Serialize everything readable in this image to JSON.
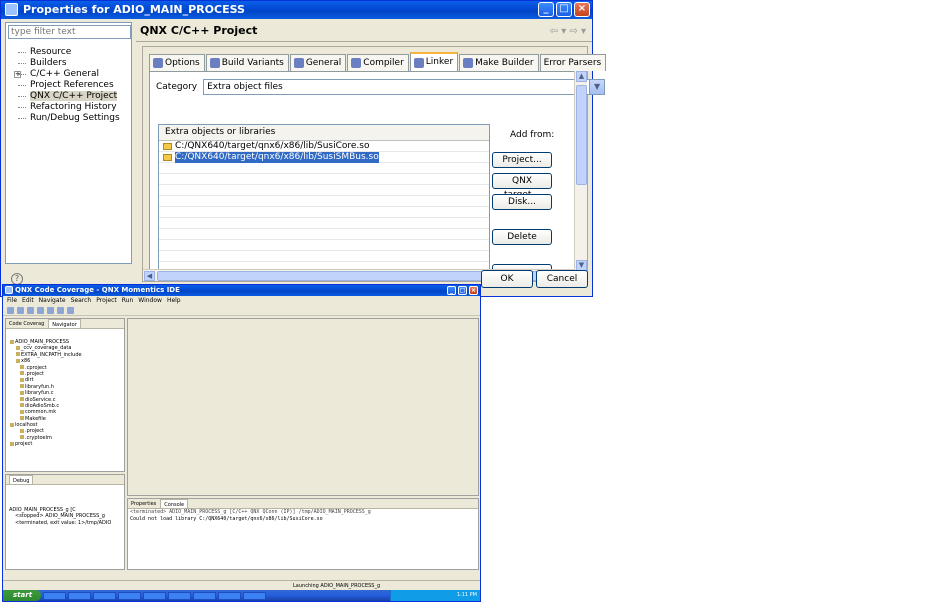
{
  "dialog": {
    "title": "Properties for ADIO_MAIN_PROCESS",
    "filter_placeholder": "type filter text",
    "nav_items": [
      "Resource",
      "Builders",
      "C/C++ General",
      "Project References",
      "QNX C/C++ Project",
      "Refactoring History",
      "Run/Debug Settings"
    ],
    "page_title": "QNX C/C++ Project",
    "tabs": [
      "Options",
      "Build Variants",
      "General",
      "Compiler",
      "Linker",
      "Make Builder",
      "Error Parsers"
    ],
    "category_label": "Category",
    "category_value": "Extra object files",
    "table_header": "Extra objects or libraries",
    "libraries": [
      "C:/QNX640/target/qnx6/x86/lib/SusiCore.so",
      "C:/QNX640/target/qnx6/x86/lib/SusiSMBus.so"
    ],
    "add_from_label": "Add from:",
    "buttons": {
      "project": "Project...",
      "qnx_target": "QNX target...",
      "disk": "Disk...",
      "delete": "Delete",
      "ok": "OK",
      "cancel": "Cancel"
    }
  },
  "ide": {
    "title": "QNX Code Coverage - QNX Momentics IDE",
    "menu": [
      "File",
      "Edit",
      "Navigate",
      "Search",
      "Project",
      "Run",
      "Window",
      "Help"
    ],
    "left_tabs": [
      "Code Coverag",
      "Navigator"
    ],
    "tree": [
      "ADIO_MAIN_PROCESS",
      "_ccv_coverage_data",
      "EXTRA_INCPATH_include",
      "x86",
      ".cproject",
      ".project",
      "dirt",
      "libraryfun.h",
      "libraryfun.c",
      "dioService.c",
      "dioAdioSmb.c",
      "common.mk",
      "Makefile",
      "localhost",
      ".project",
      ".cryptoelm",
      "project"
    ],
    "debug_tab": "Debug",
    "debug_lines": [
      "ADIO_MAIN_PROCESS_g [C",
      "<stopped> ADIO_MAIN_PROCESS_g",
      "<terminated, exit value: 1>/tmp/ADIO"
    ],
    "console_tabs": [
      "Properties",
      "Console"
    ],
    "console_header": "<terminated> ADIO_MAIN_PROCESS_g [C/C++ QNX QConn (IP)] /tmp/ADIO_MAIN_PROCESS_g",
    "console_output": "Could not load library C:/QNX640/target/qnx6/x86/lib/SusiCore.so",
    "status": "Launching ADIO_MAIN_PROCESS_g",
    "start_label": "start",
    "clock": "1:11 PM"
  }
}
